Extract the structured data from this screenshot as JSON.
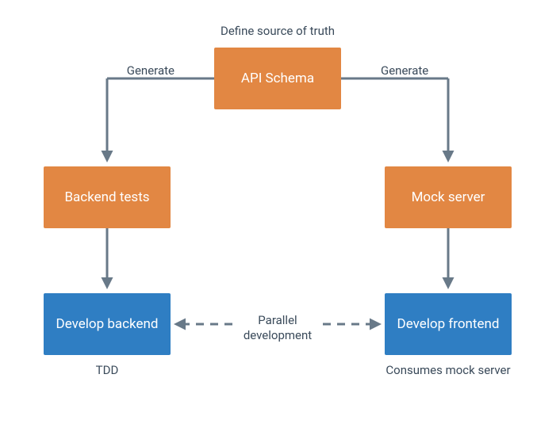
{
  "diagram": {
    "top_caption": "Define source of truth",
    "nodes": {
      "api_schema": "API Schema",
      "backend_tests": "Backend tests",
      "mock_server": "Mock server",
      "develop_backend": "Develop backend",
      "develop_frontend": "Develop frontend"
    },
    "edge_labels": {
      "generate_left": "Generate",
      "generate_right": "Generate",
      "parallel_dev": "Parallel\ndevelopment"
    },
    "bottom_captions": {
      "tdd": "TDD",
      "consumes_mock": "Consumes mock server"
    },
    "colors": {
      "orange": "#e28743",
      "blue": "#2f7ec3",
      "arrow": "#687988",
      "text": "#3a4a5a"
    }
  }
}
